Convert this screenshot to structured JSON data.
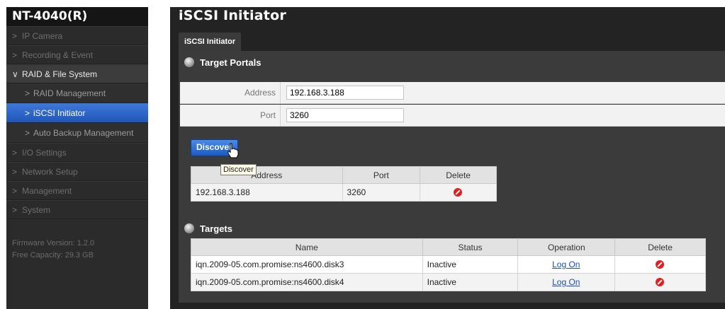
{
  "sidebar": {
    "device_title": "NT-4040(R)",
    "items": [
      {
        "label": "IP Camera"
      },
      {
        "label": "Recording & Event"
      },
      {
        "label": "RAID & File System"
      },
      {
        "label": "I/O Settings"
      },
      {
        "label": "Network Setup"
      },
      {
        "label": "Management"
      },
      {
        "label": "System"
      }
    ],
    "subitems": [
      {
        "label": "RAID Management"
      },
      {
        "label": "iSCSI Initiator"
      },
      {
        "label": "Auto Backup Management"
      }
    ],
    "firmware": "Firmware Version: 1.2.0",
    "free_capacity": "Free Capacity: 29.3 GB"
  },
  "main": {
    "page_title": "iSCSI Initiator",
    "tab_label": "iSCSI Initiator",
    "portals": {
      "heading": "Target Portals",
      "address_label": "Address",
      "address_value": "192.168.3.188",
      "port_label": "Port",
      "port_value": "3260",
      "discover_label": "Discover",
      "tooltip": "Discover",
      "table": {
        "headers": [
          "Address",
          "Port",
          "Delete"
        ],
        "rows": [
          {
            "address": "192.168.3.188",
            "port": "3260"
          }
        ]
      }
    },
    "targets": {
      "heading": "Targets",
      "headers": [
        "Name",
        "Status",
        "Operation",
        "Delete"
      ],
      "rows": [
        {
          "name": "iqn.2009-05.com.promise:ns4600.disk3",
          "status": "Inactive",
          "operation": "Log On"
        },
        {
          "name": "iqn.2009-05.com.promise:ns4600.disk4",
          "status": "Inactive",
          "operation": "Log On"
        }
      ]
    }
  },
  "colors": {
    "accent_blue": "#2a66cf",
    "delete_red": "#e02020",
    "link_blue": "#1a4fb5"
  }
}
